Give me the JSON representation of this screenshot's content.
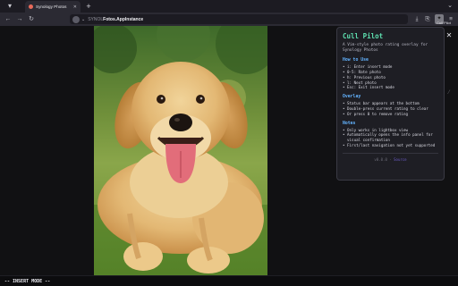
{
  "browser": {
    "tab": {
      "title": "Synology Photos"
    },
    "url": {
      "host": "SYNOL",
      "path": "Fotos.AppInstance"
    },
    "tooltip": "Cull Pilot"
  },
  "overlay": {
    "title": "Cull Pilot",
    "subtitle": "A Vim-style photo rating overlay for Synology Photos",
    "sections": [
      {
        "heading": "How to Use",
        "items": [
          "i: Enter insert mode",
          "0-5: Rate photo",
          "h: Previous photo",
          "l: Next photo",
          "Esc: Exit insert mode"
        ]
      },
      {
        "heading": "Overlay",
        "items": [
          "Status bar appears at the bottom",
          "Double-press current rating to clear",
          "Or press 0 to remove rating"
        ]
      },
      {
        "heading": "Notes",
        "items": [
          "Only works in lightbox view",
          "Automatically opens the info panel for visual confirmation",
          "First/last navigation not yet supported"
        ]
      }
    ],
    "footer": {
      "version": "v0.0.0",
      "separator": "·",
      "link": "Source"
    }
  },
  "status": {
    "text": "-- INSERT MODE --"
  },
  "icons": {
    "tab_list": "tab-list-icon",
    "back": "back-arrow-icon",
    "forward": "forward-arrow-icon",
    "reload": "reload-icon",
    "download": "download-icon",
    "share": "share-icon",
    "extension": "extension-icon",
    "menu": "menu-icon",
    "close": "close-icon"
  },
  "colors": {
    "accent_title": "#5ee0b0",
    "accent_heading": "#63b3ff",
    "link": "#6c5cc8"
  }
}
